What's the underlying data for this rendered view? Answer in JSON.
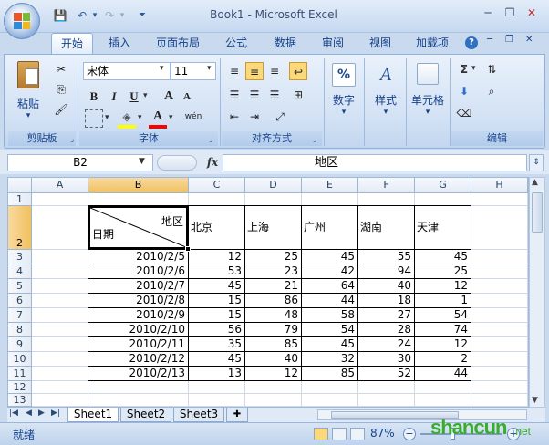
{
  "title_bar": {
    "title": "Book1 - Microsoft Excel",
    "qat": {
      "save_icon": "save-icon",
      "undo_icon": "undo-icon",
      "redo_icon": "redo-icon"
    }
  },
  "ribbon_tabs": [
    "开始",
    "插入",
    "页面布局",
    "公式",
    "数据",
    "审阅",
    "视图",
    "加载项"
  ],
  "active_tab": "开始",
  "ribbon": {
    "clipboard": {
      "label": "剪贴板",
      "paste": "粘贴"
    },
    "font": {
      "label": "字体",
      "font_name": "宋体",
      "font_size": "11",
      "bold": "B",
      "italic": "I",
      "underline": "U",
      "grow": "A",
      "shrink": "A",
      "fill_color": "#ffff00",
      "font_color": "#ff0000",
      "phonetic": "wén"
    },
    "alignment": {
      "label": "对齐方式"
    },
    "number": {
      "label": "数字",
      "symbol": "%"
    },
    "styles": {
      "label": "样式",
      "symbol": "A"
    },
    "cells": {
      "label": "单元格"
    },
    "editing": {
      "label": "编辑",
      "sum": "Σ"
    }
  },
  "formula_bar": {
    "name_box": "B2",
    "fx": "fx",
    "value": "地区"
  },
  "grid": {
    "columns": [
      "A",
      "B",
      "C",
      "D",
      "E",
      "F",
      "G",
      "H"
    ],
    "rows": [
      "1",
      "2",
      "3",
      "4",
      "5",
      "6",
      "7",
      "8",
      "9",
      "10",
      "11",
      "12",
      "13"
    ],
    "selected_cell": "B2",
    "header_diag": {
      "top_right": "地区",
      "bottom_left": "日期"
    },
    "city_headers": [
      "北京",
      "上海",
      "广州",
      "湖南",
      "天津"
    ],
    "data": [
      {
        "date": "2010/2/5",
        "values": [
          "12",
          "25",
          "45",
          "55",
          "45"
        ]
      },
      {
        "date": "2010/2/6",
        "values": [
          "53",
          "23",
          "42",
          "94",
          "25"
        ]
      },
      {
        "date": "2010/2/7",
        "values": [
          "45",
          "21",
          "64",
          "40",
          "12"
        ]
      },
      {
        "date": "2010/2/8",
        "values": [
          "15",
          "86",
          "44",
          "18",
          "1"
        ]
      },
      {
        "date": "2010/2/9",
        "values": [
          "15",
          "48",
          "58",
          "27",
          "54"
        ]
      },
      {
        "date": "2010/2/10",
        "values": [
          "56",
          "79",
          "54",
          "28",
          "74"
        ]
      },
      {
        "date": "2010/2/11",
        "values": [
          "35",
          "85",
          "45",
          "24",
          "12"
        ]
      },
      {
        "date": "2010/2/12",
        "values": [
          "45",
          "40",
          "32",
          "30",
          "2"
        ]
      },
      {
        "date": "2010/2/13",
        "values": [
          "13",
          "12",
          "85",
          "52",
          "44"
        ]
      }
    ]
  },
  "sheets": [
    "Sheet1",
    "Sheet2",
    "Sheet3"
  ],
  "active_sheet": "Sheet1",
  "status": {
    "mode": "就绪",
    "zoom": "87%"
  },
  "watermark": {
    "brand": "shancun",
    "suffix": ".net"
  }
}
